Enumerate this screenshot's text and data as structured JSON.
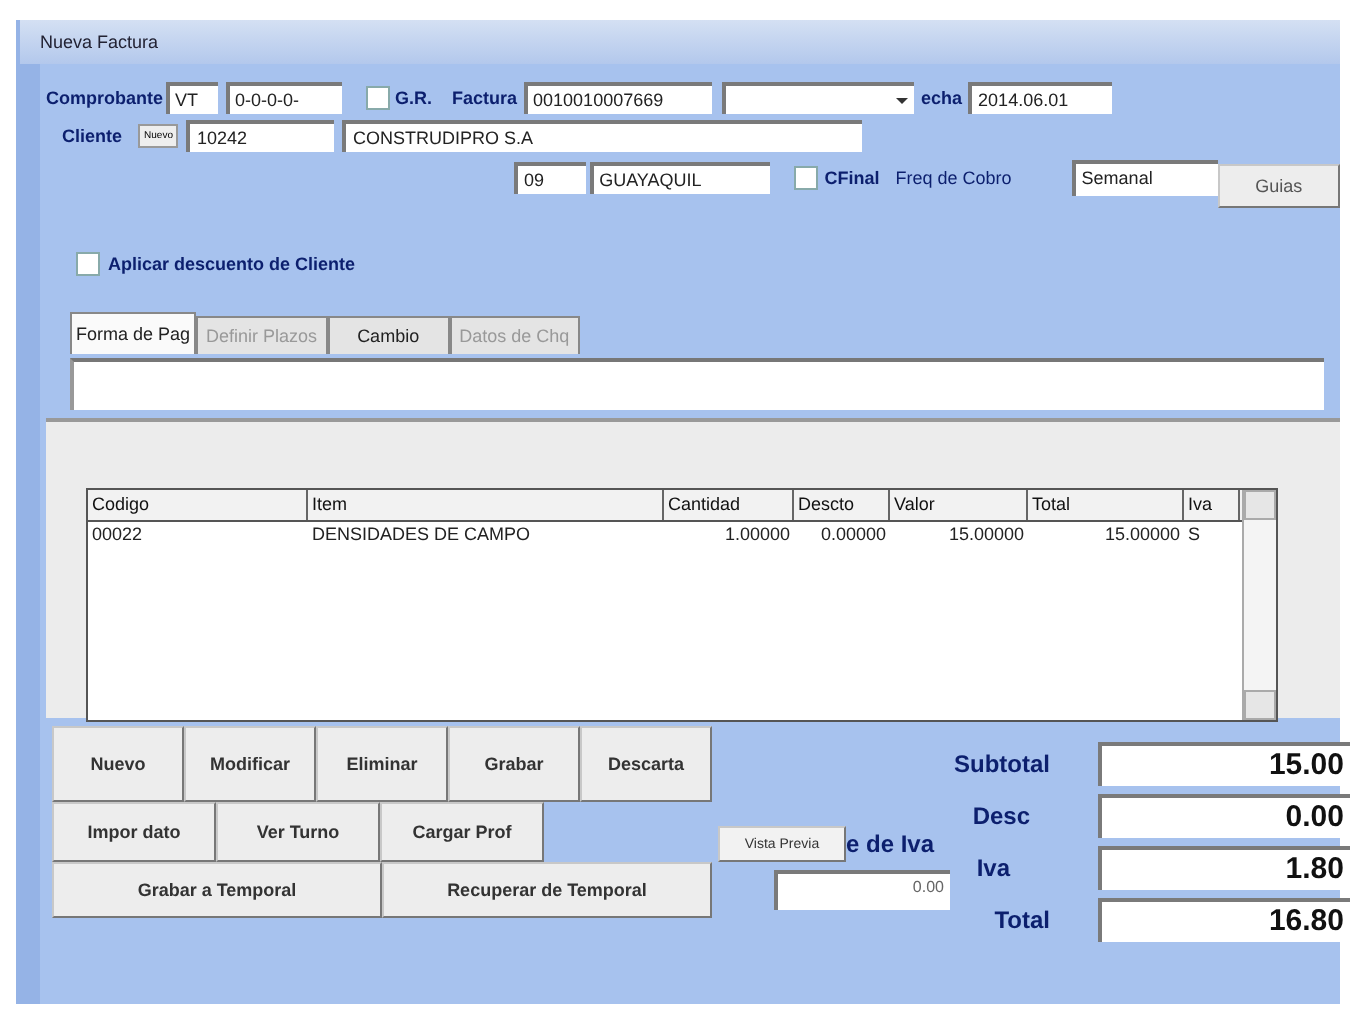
{
  "window": {
    "title": "Nueva Factura"
  },
  "header": {
    "comprobante": {
      "label": "Comprobante",
      "type": "VT",
      "number": "0-0-0-0-"
    },
    "gr": {
      "label": "G.R.",
      "checked": false
    },
    "factura": {
      "label": "Factura",
      "value": "0010010007669"
    },
    "fecha": {
      "label": "echa",
      "value": "2014.06.01"
    },
    "cliente": {
      "label": "Cliente",
      "button": "Nuevo",
      "code": "10242",
      "name": "CONSTRUDIPRO S.A"
    },
    "city": {
      "code": "09",
      "name": "GUAYAQUIL"
    },
    "cfinal": {
      "label": "CFinal",
      "checked": false
    },
    "freq": {
      "label": "Freq de Cobro",
      "value": "Semanal"
    },
    "guias_button": "Guias",
    "discount": {
      "label": "Aplicar descuento de Cliente",
      "checked": false
    }
  },
  "tabs": [
    {
      "label": "Forma de Pag",
      "selected": true,
      "disabled": false
    },
    {
      "label": "Definir Plazos",
      "selected": false,
      "disabled": true
    },
    {
      "label": "Cambio",
      "selected": false,
      "disabled": false
    },
    {
      "label": "Datos de Chq",
      "selected": false,
      "disabled": true
    }
  ],
  "table": {
    "columns": [
      "Codigo",
      "Item",
      "Cantidad",
      "Descto",
      "Valor",
      "Total",
      "Iva"
    ],
    "rows": [
      [
        "00022",
        "DENSIDADES DE CAMPO",
        "1.00000",
        "0.00000",
        "15.00000",
        "15.00000",
        "S"
      ]
    ]
  },
  "buttons": [
    [
      "Nuevo",
      "Modificar",
      "Eliminar",
      "Grabar",
      "Descarta"
    ],
    [
      "Impor dato",
      "Ver Turno",
      "Cargar Prof"
    ],
    [
      "Grabar a Temporal",
      "Recuperar de Temporal"
    ]
  ],
  "preview_button": "Vista Previa",
  "iva_rate": {
    "label": "e de Iva",
    "value": "0.00"
  },
  "totals": [
    {
      "label": "Subtotal",
      "value": "15.00"
    },
    {
      "label": "Desc",
      "value": "0.00"
    },
    {
      "label": "Iva",
      "value": "1.80"
    },
    {
      "label": "Total",
      "value": "16.80"
    }
  ]
}
